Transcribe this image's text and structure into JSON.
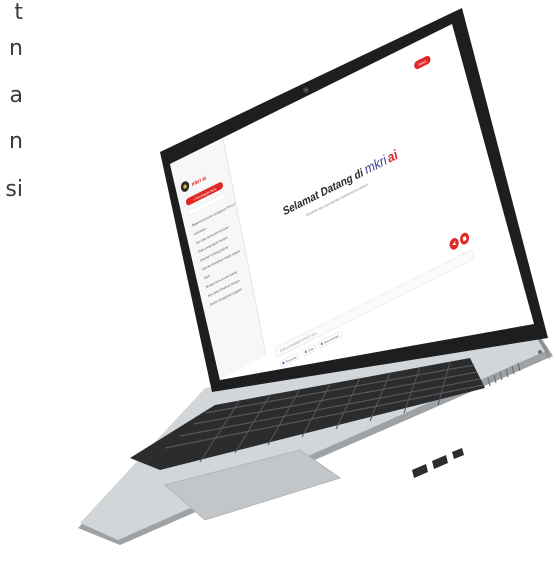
{
  "left_text_fragments": [
    "t",
    "n",
    "a",
    "n",
    "si"
  ],
  "app": {
    "logo_text": "mkri ai",
    "new_chat_label": "+ Percakapan Baru",
    "history_items": [
      "Bagaimana proses pengajuan PHPU?",
      "Ketentuan",
      "Apa saja syarat permohonan",
      "Siapa yang dapat menjadi",
      "Jelaskan tentang judicial",
      "Hak dan kewajiban warga negara",
      "Hasil",
      "Berapa lama proses sidang",
      "Apa yang dimaksud dengan",
      "Syarat mengajukan gugatan"
    ],
    "top_button_label": "Masuk",
    "welcome_prefix": "Selamat Datang di",
    "welcome_brand": "mkri",
    "welcome_brand_suffix": "ai",
    "welcome_subtitle": "Tanyakan apa saja seputar Mahkamah Konstitusi",
    "input_placeholder": "Ketik pertanyaan Anda di sini...",
    "chips": [
      "Pencarian",
      "Chat",
      "Rekomendasi"
    ]
  },
  "colors": {
    "accent": "#e02828",
    "bezel": "#1d1e20",
    "body": "#c9ccce",
    "keys": "#2b2c2e"
  }
}
